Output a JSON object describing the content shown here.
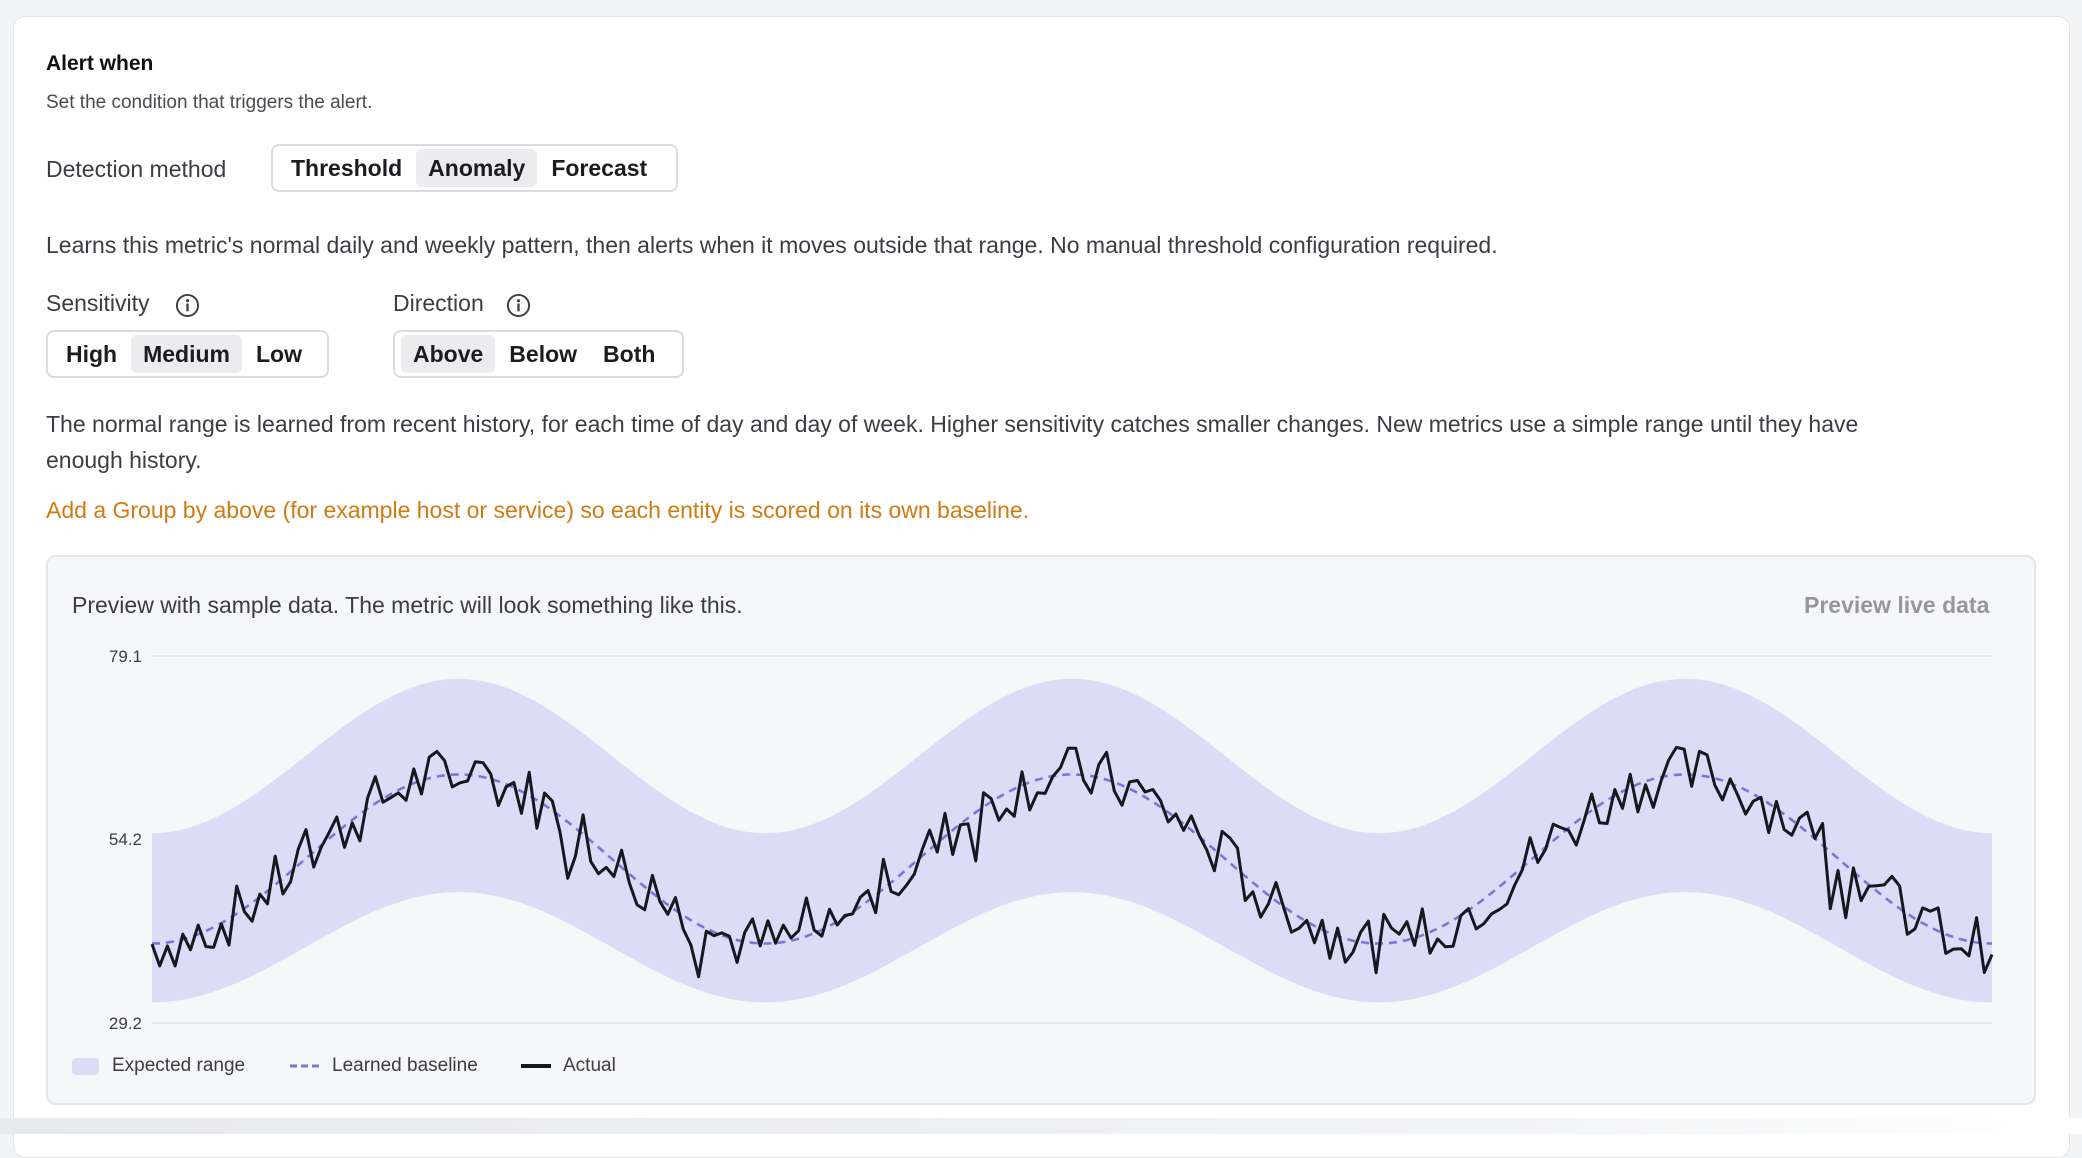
{
  "section": {
    "title": "Alert when",
    "subtitle": "Set the condition that triggers the alert."
  },
  "detection": {
    "label": "Detection method",
    "options": [
      "Threshold",
      "Anomaly",
      "Forecast"
    ],
    "selected": "Anomaly",
    "description": "Learns this metric's normal daily and weekly pattern, then alerts when it moves outside that range. No manual threshold configuration required."
  },
  "sensitivity": {
    "label": "Sensitivity",
    "options": [
      "High",
      "Medium",
      "Low"
    ],
    "selected": "Medium"
  },
  "direction": {
    "label": "Direction",
    "options": [
      "Above",
      "Below",
      "Both"
    ],
    "selected": "Above"
  },
  "explanation": {
    "line1": "The normal range is learned from recent history, for each time of day and day of week. Higher sensitivity catches smaller changes. New metrics use a simple range until they have",
    "line2": "enough history."
  },
  "warning": "Add a Group by above (for example host or service) so each entity is scored on its own baseline.",
  "preview": {
    "text": "Preview with sample data. The metric will look something like this.",
    "live_link": "Preview live data"
  },
  "colors": {
    "range_fill": "#dcdcf6",
    "baseline": "#7a76d8",
    "actual": "#17171f",
    "warning": "#d17a12"
  },
  "chart_data": {
    "type": "line",
    "ylim": [
      29.2,
      79.1
    ],
    "yticks": [
      "79.1",
      "54.2",
      "29.2"
    ],
    "grid": true,
    "legend_position": "bottom-left",
    "legend": [
      "Expected range",
      "Learned baseline",
      "Actual"
    ],
    "n_points": 240,
    "expected_range": {
      "upper": {
        "min": 55,
        "max": 76,
        "periods": 3
      },
      "lower": {
        "min": 32,
        "max": 47,
        "periods": 3
      }
    },
    "baseline": {
      "min": 40,
      "max": 63,
      "periods": 3
    },
    "actual_noise_amplitude": 4
  }
}
